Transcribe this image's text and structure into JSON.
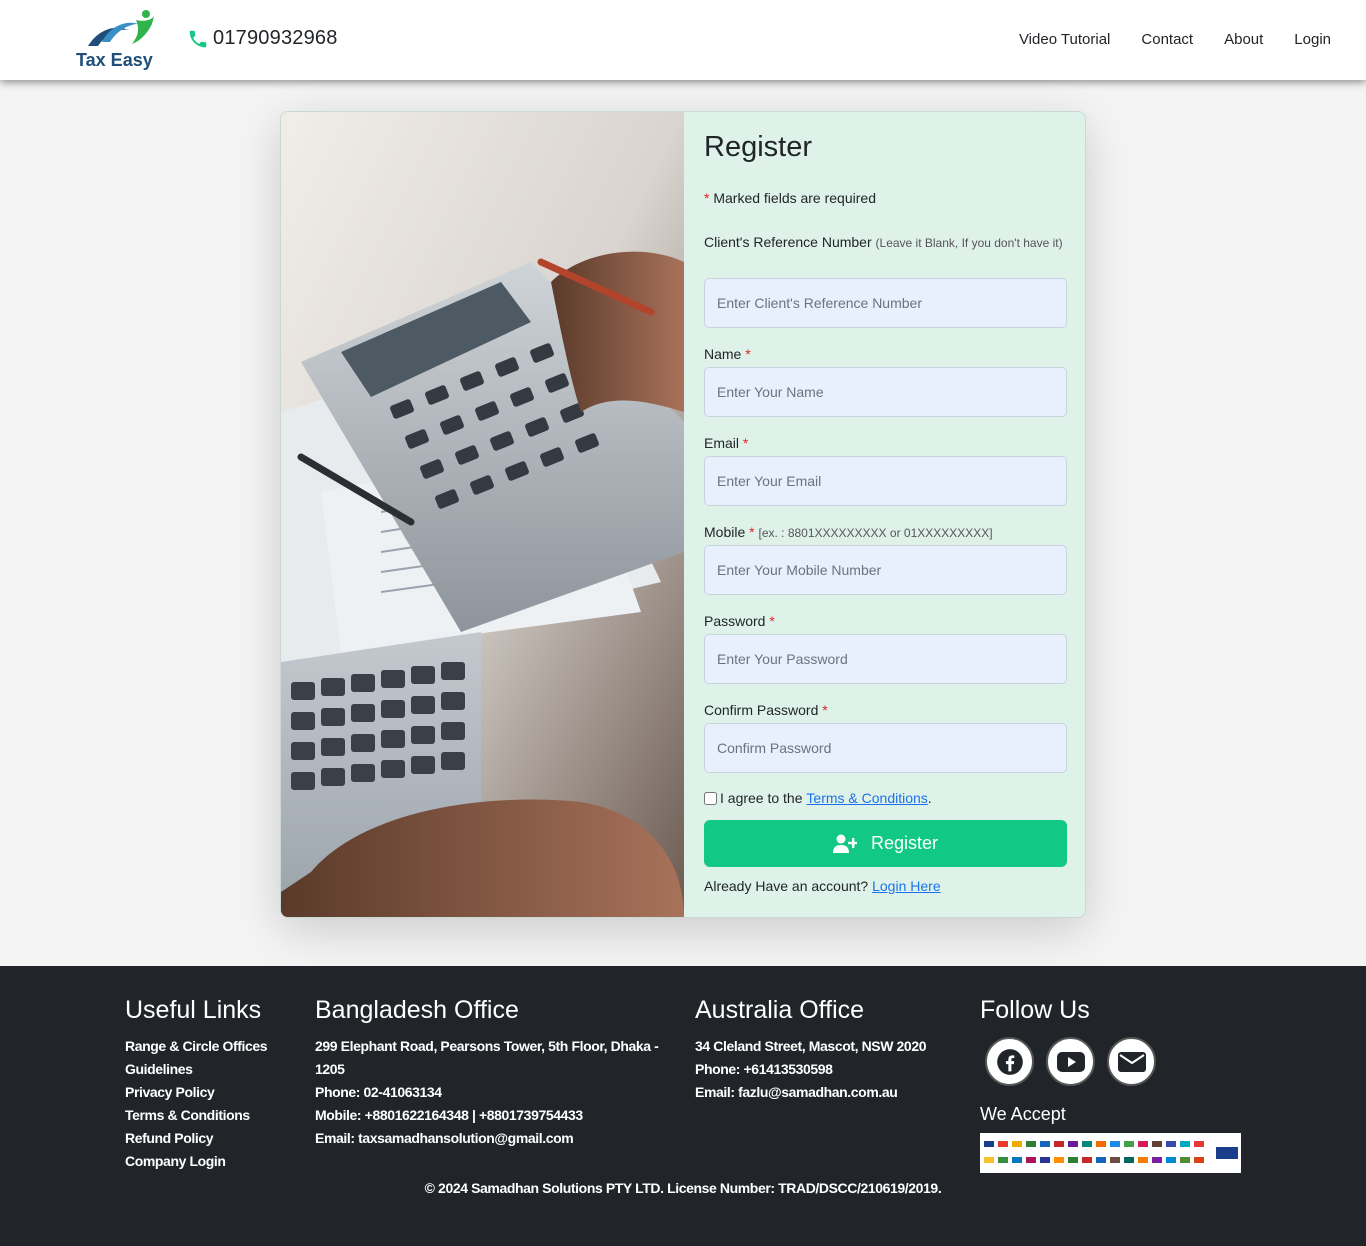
{
  "header": {
    "logo_text": "Tax Easy",
    "phone": "01790932968",
    "nav": [
      {
        "label": "Video Tutorial"
      },
      {
        "label": "Contact"
      },
      {
        "label": "About"
      },
      {
        "label": "Login"
      }
    ]
  },
  "form": {
    "title": "Register",
    "required_note": "Marked fields are required",
    "ref_label": "Client's Reference Number",
    "ref_hint": "(Leave it Blank, If you don't have it)",
    "ref_placeholder": "Enter Client's Reference Number",
    "name_label": "Name",
    "name_placeholder": "Enter Your Name",
    "email_label": "Email",
    "email_placeholder": "Enter Your Email",
    "mobile_label": "Mobile",
    "mobile_hint": "[ex. : 8801XXXXXXXXX or 01XXXXXXXXX]",
    "mobile_placeholder": "Enter Your Mobile Number",
    "password_label": "Password",
    "password_placeholder": "Enter Your Password",
    "confirm_label": "Confirm Password",
    "confirm_placeholder": "Confirm Password",
    "agree_prefix": "I agree to the",
    "terms_link": "Terms & Conditions",
    "agree_suffix": ".",
    "register_button": "Register",
    "already_text": "Already Have an account?",
    "login_link": "Login Here",
    "required_mark": "*"
  },
  "footer": {
    "useful_links_title": "Useful Links",
    "useful_links": [
      "Range & Circle Offices",
      "Guidelines",
      "Privacy Policy",
      "Terms & Conditions",
      "Refund Policy",
      "Company Login"
    ],
    "bd_title": "Bangladesh Office",
    "bd_address": "299 Elephant Road, Pearsons Tower, 5th Floor, Dhaka - 1205",
    "bd_phone": "Phone: 02-41063134",
    "bd_mobile": "Mobile: +8801622164348 | +8801739754433",
    "bd_email": "Email: taxsamadhansolution@gmail.com",
    "au_title": "Australia Office",
    "au_address": "34 Cleland Street, Mascot, NSW 2020",
    "au_phone": "Phone: +61413530598",
    "au_email": "Email: fazlu@samadhan.com.au",
    "follow_title": "Follow Us",
    "social_icons": [
      "facebook-icon",
      "youtube-icon",
      "envelope-icon"
    ],
    "we_accept": "We Accept",
    "copyright": "© 2024 Samadhan Solutions PTY LTD. License Number: TRAD/DSCC/210619/2019."
  },
  "colors": {
    "accent_green": "#11c884",
    "form_bg": "#def2ea",
    "footer_bg": "#212529",
    "link_blue": "#1a73e8",
    "required_red": "#e02424"
  }
}
